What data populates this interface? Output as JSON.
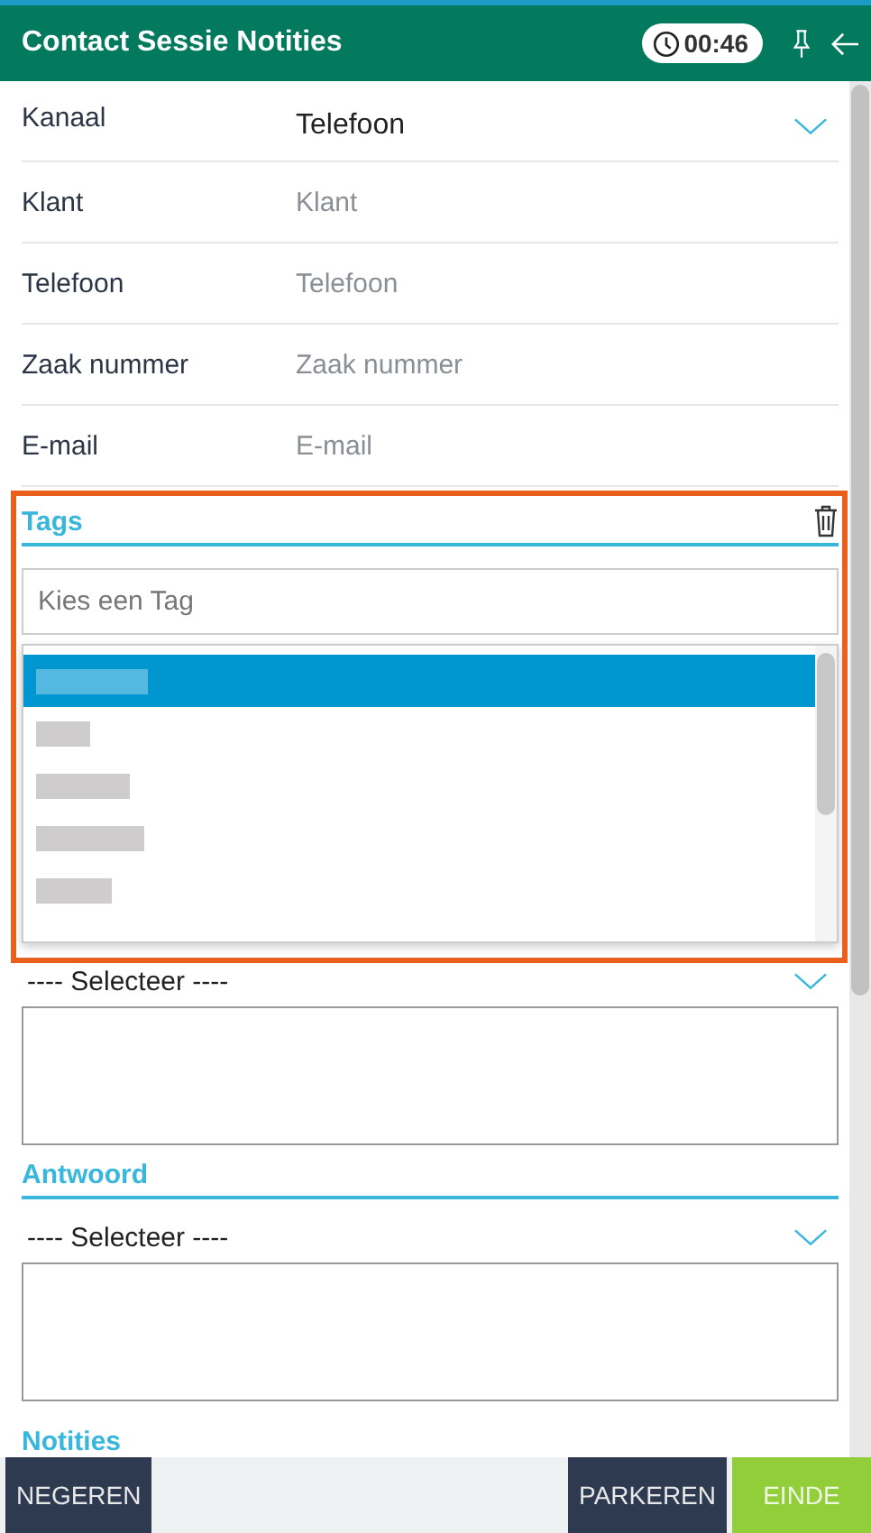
{
  "header": {
    "title": "Contact Sessie Notities",
    "timer": "00:46"
  },
  "fields": [
    {
      "label": "Kanaal",
      "value": "Telefoon",
      "kind": "select"
    },
    {
      "label": "Klant",
      "placeholder": "Klant",
      "kind": "text"
    },
    {
      "label": "Telefoon",
      "placeholder": "Telefoon",
      "kind": "text"
    },
    {
      "label": "Zaak nummer",
      "placeholder": "Zaak nummer",
      "kind": "text"
    },
    {
      "label": "E-mail",
      "placeholder": "E-mail",
      "kind": "text"
    }
  ],
  "tags": {
    "heading": "Tags",
    "search_placeholder": "Kies een Tag",
    "options": [
      {
        "selected": true
      },
      {
        "selected": false
      },
      {
        "selected": false
      },
      {
        "selected": false
      },
      {
        "selected": false
      }
    ]
  },
  "sections": [
    {
      "select": "---- Selecteer ----"
    },
    {
      "heading": "Antwoord",
      "select": "---- Selecteer ----"
    }
  ],
  "notes_heading": "Notities",
  "buttons": [
    {
      "label": "NEGEREN",
      "kind": "dark"
    },
    {
      "label": "PARKEREN",
      "kind": "dark"
    },
    {
      "label": "EINDE",
      "kind": "green"
    }
  ]
}
